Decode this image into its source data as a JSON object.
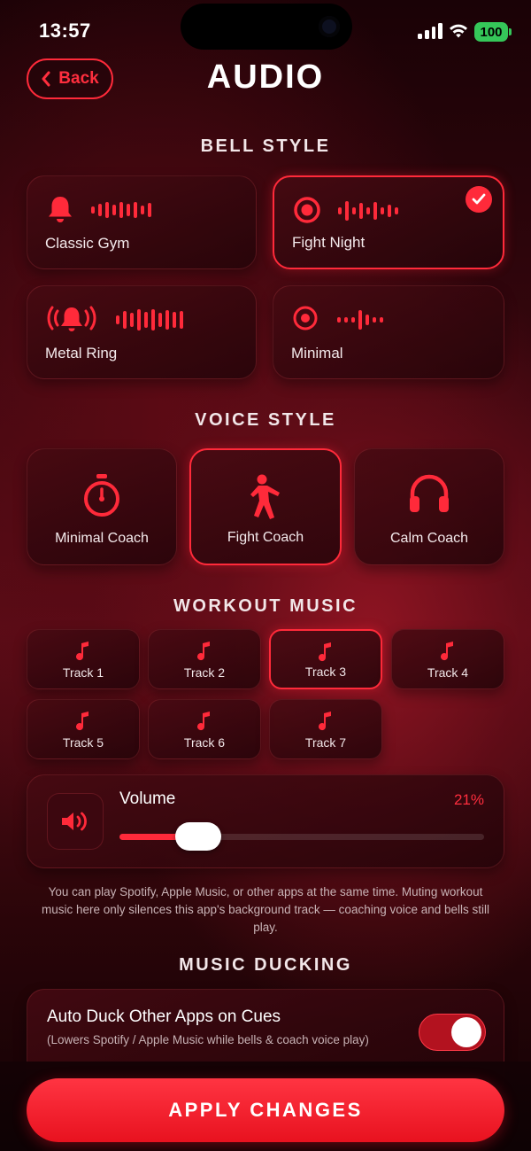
{
  "status": {
    "time": "13:57",
    "battery": "100"
  },
  "header": {
    "back_label": "Back",
    "title": "AUDIO"
  },
  "bell_section": {
    "title": "BELL STYLE",
    "options": [
      {
        "label": "Classic Gym",
        "selected": false,
        "icon": "bell-icon"
      },
      {
        "label": "Fight Night",
        "selected": true,
        "icon": "target-icon"
      },
      {
        "label": "Metal Ring",
        "selected": false,
        "icon": "ringing-bell-icon"
      },
      {
        "label": "Minimal",
        "selected": false,
        "icon": "dot-circle-icon"
      }
    ]
  },
  "voice_section": {
    "title": "VOICE STYLE",
    "options": [
      {
        "label": "Minimal Coach",
        "selected": false,
        "icon": "stopwatch-icon"
      },
      {
        "label": "Fight Coach",
        "selected": true,
        "icon": "fighter-icon"
      },
      {
        "label": "Calm Coach",
        "selected": false,
        "icon": "headphones-icon"
      }
    ]
  },
  "music_section": {
    "title": "WORKOUT MUSIC",
    "tracks": [
      {
        "label": "Track 1",
        "selected": false
      },
      {
        "label": "Track 2",
        "selected": false
      },
      {
        "label": "Track 3",
        "selected": true
      },
      {
        "label": "Track 4",
        "selected": false
      },
      {
        "label": "Track 5",
        "selected": false
      },
      {
        "label": "Track 6",
        "selected": false
      },
      {
        "label": "Track 7",
        "selected": false
      }
    ]
  },
  "volume": {
    "label": "Volume",
    "value_text": "21%",
    "value": 0.21
  },
  "note": "You can play Spotify, Apple Music, or other apps at the same time. Muting workout music here only silences this app's background track — coaching voice and bells still play.",
  "ducking_section": {
    "title": "MUSIC DUCKING",
    "toggle_title": "Auto Duck Other Apps on Cues",
    "toggle_subtitle": "(Lowers Spotify / Apple Music while bells & coach voice play)",
    "enabled": true
  },
  "apply_label": "APPLY CHANGES",
  "colors": {
    "accent": "#ff2a3a",
    "battery": "#35c759"
  }
}
